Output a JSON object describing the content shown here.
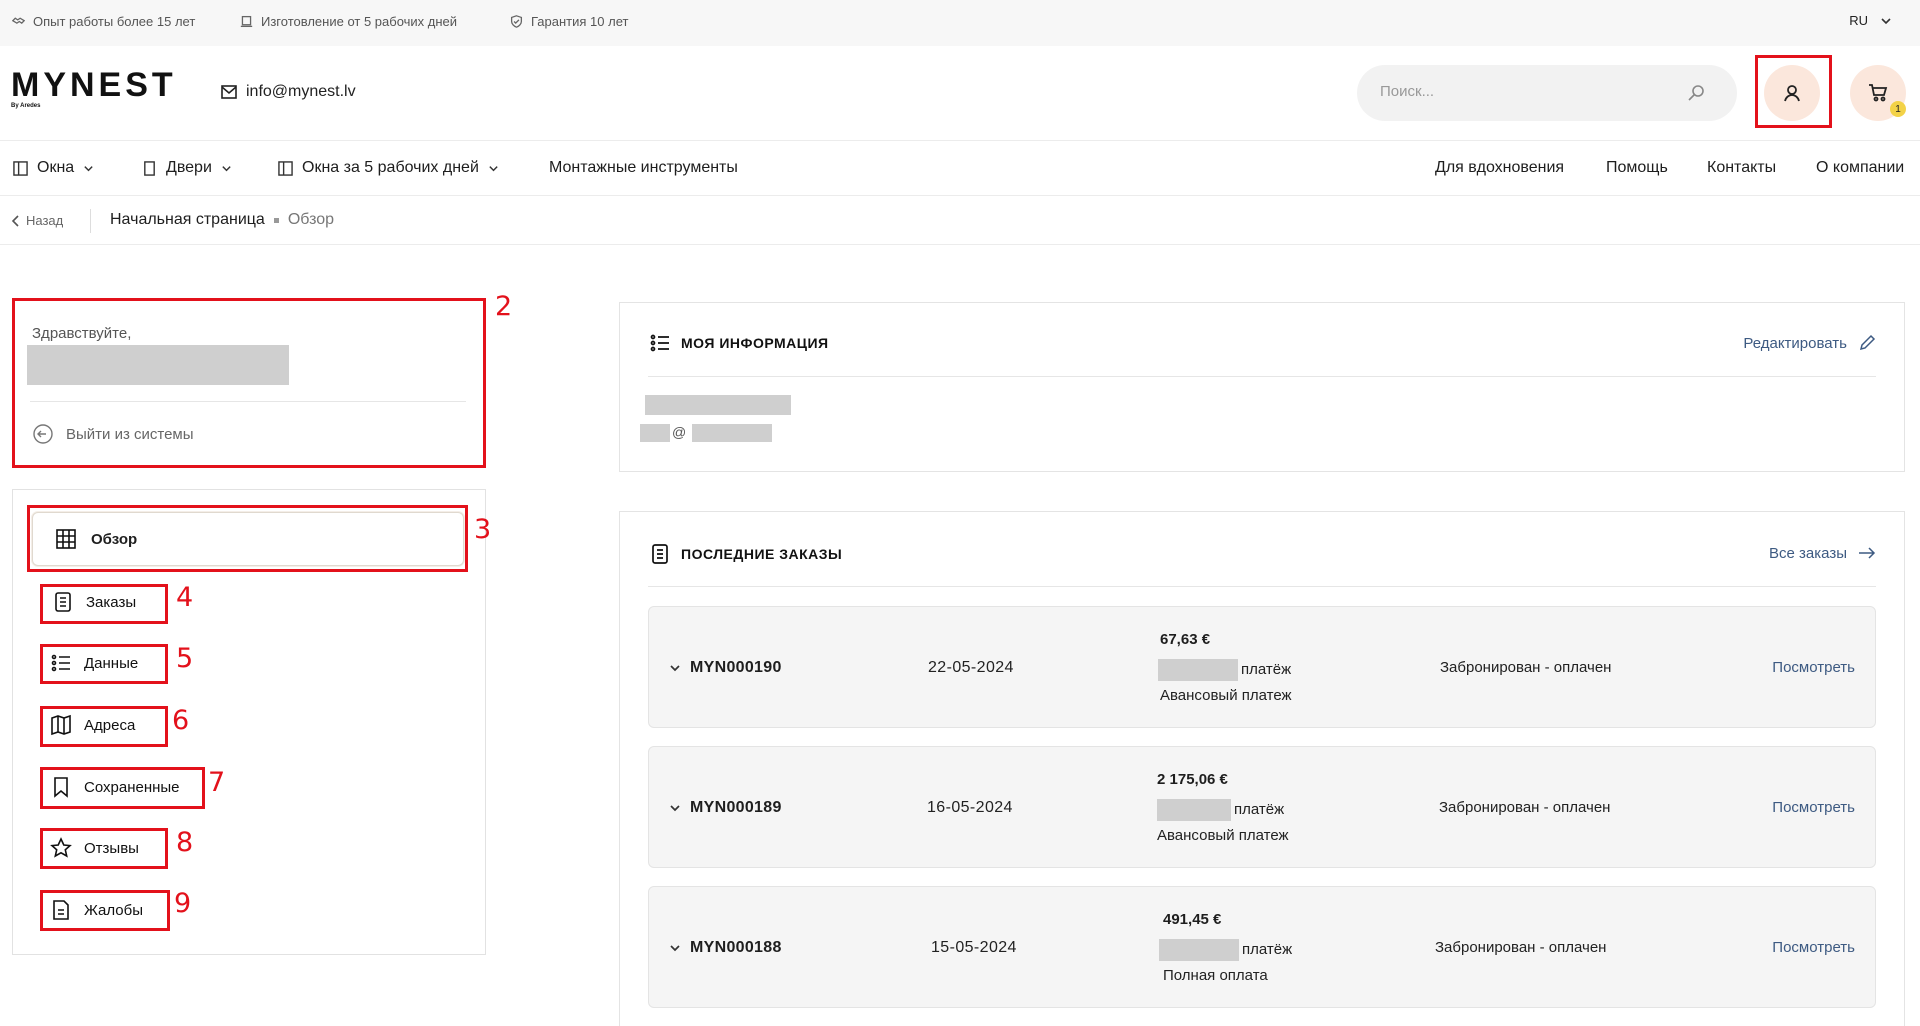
{
  "topbar": {
    "usps": [
      "Опыт работы более 15 лет",
      "Изготовление от 5 рабочих дней",
      "Гарантия 10 лет"
    ],
    "language": "RU"
  },
  "header": {
    "logo_text": "MYNEST",
    "logo_sub": "By Aredes",
    "email": "info@mynest.lv",
    "search_placeholder": "Поиск...",
    "cart_count": "1"
  },
  "nav": {
    "left": [
      "Окна",
      "Двери",
      "Окна за 5 рабочих дней",
      "Монтажные инструменты"
    ],
    "right": [
      "Для вдохновения",
      "Помощь",
      "Контакты",
      "О компании"
    ]
  },
  "breadcrumb": {
    "back": "Назад",
    "home": "Начальная страница",
    "current": "Обзор"
  },
  "sidebar": {
    "greeting": "Здравствуйте,",
    "logout": "Выйти из системы",
    "items": [
      "Обзор",
      "Заказы",
      "Данные",
      "Адреса",
      "Сохраненные",
      "Отзывы",
      "Жалобы"
    ]
  },
  "annotations": [
    "2",
    "3",
    "4",
    "5",
    "6",
    "7",
    "8",
    "9"
  ],
  "my_info": {
    "title": "МОЯ ИНФОРМАЦИЯ",
    "edit": "Редактировать",
    "email_at": "@"
  },
  "orders": {
    "title": "ПОСЛЕДНИЕ ЗАКАЗЫ",
    "all_link": "Все заказы",
    "rows": [
      {
        "id": "MYN000190",
        "date": "22-05-2024",
        "amount": "67,63 €",
        "payment_suffix": "платёж",
        "payment_type": "Авансовый платеж",
        "status": "Забронирован - оплачен",
        "view": "Посмотреть"
      },
      {
        "id": "MYN000189",
        "date": "16-05-2024",
        "amount": "2 175,06 €",
        "payment_suffix": "платёж",
        "payment_type": "Авансовый платеж",
        "status": "Забронирован - оплачен",
        "view": "Посмотреть"
      },
      {
        "id": "MYN000188",
        "date": "15-05-2024",
        "amount": "491,45 €",
        "payment_suffix": "платёж",
        "payment_type": "Полная оплата",
        "status": "Забронирован - оплачен",
        "view": "Посмотреть"
      }
    ]
  },
  "colors": {
    "annotation_red": "#e3111b",
    "link_blue": "#3d5a82",
    "button_peach": "#fbe7dc",
    "badge_yellow": "#f3d247"
  }
}
